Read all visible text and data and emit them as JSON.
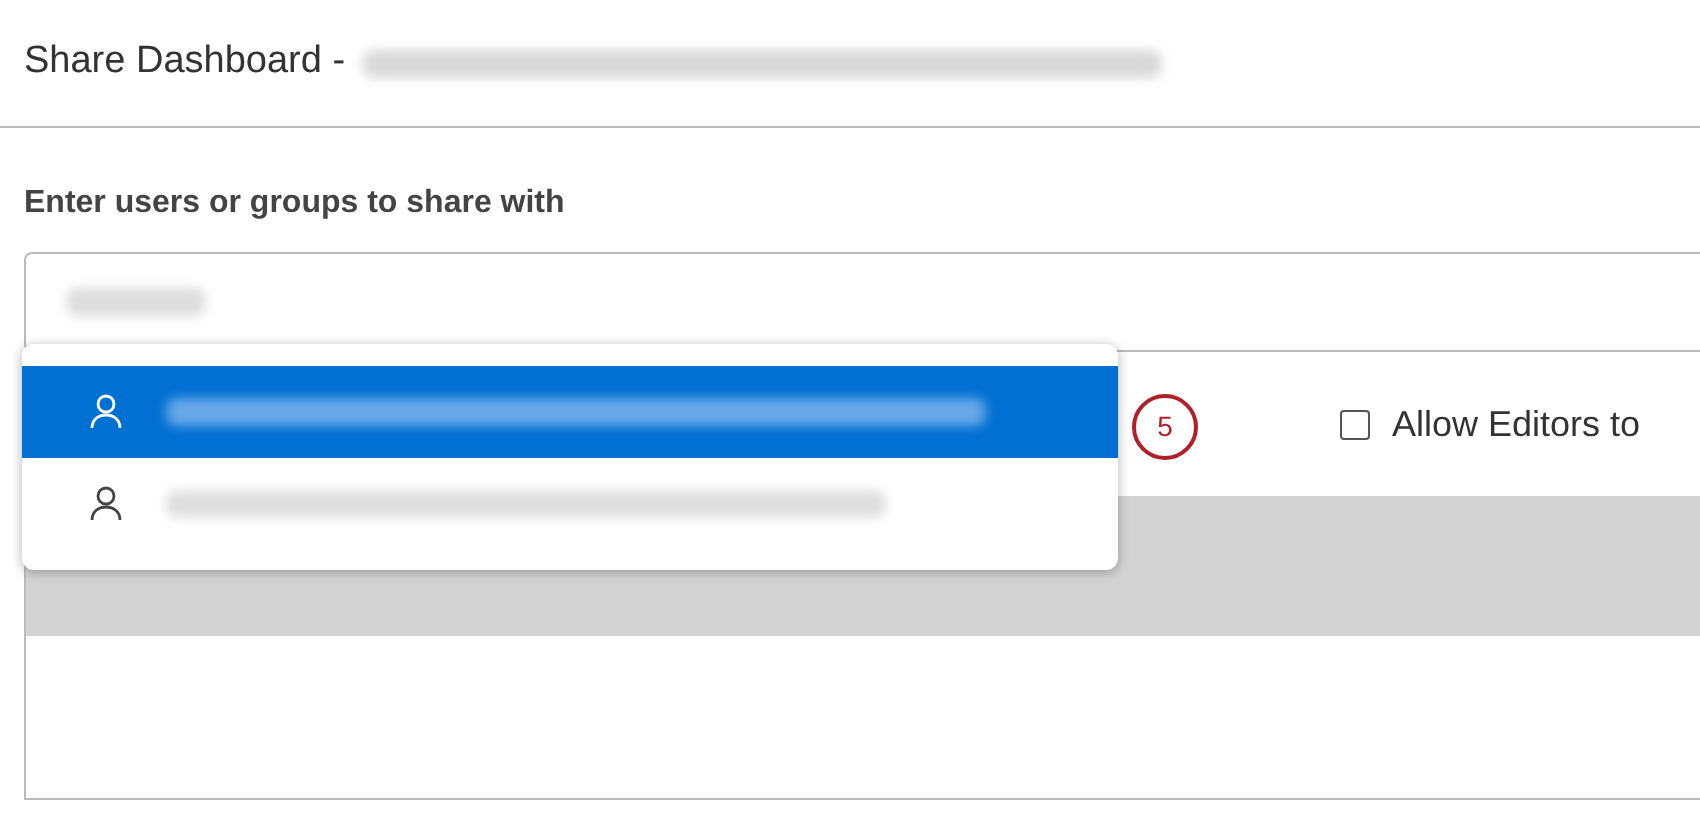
{
  "header": {
    "title": "Share Dashboard -"
  },
  "share": {
    "label": "Enter users or groups to share with"
  },
  "suggestions": [
    {
      "selected": true
    },
    {
      "selected": false
    }
  ],
  "annotation": {
    "number": "5"
  },
  "options": [
    {
      "label": "Allow Editors to",
      "checked": false
    }
  ]
}
